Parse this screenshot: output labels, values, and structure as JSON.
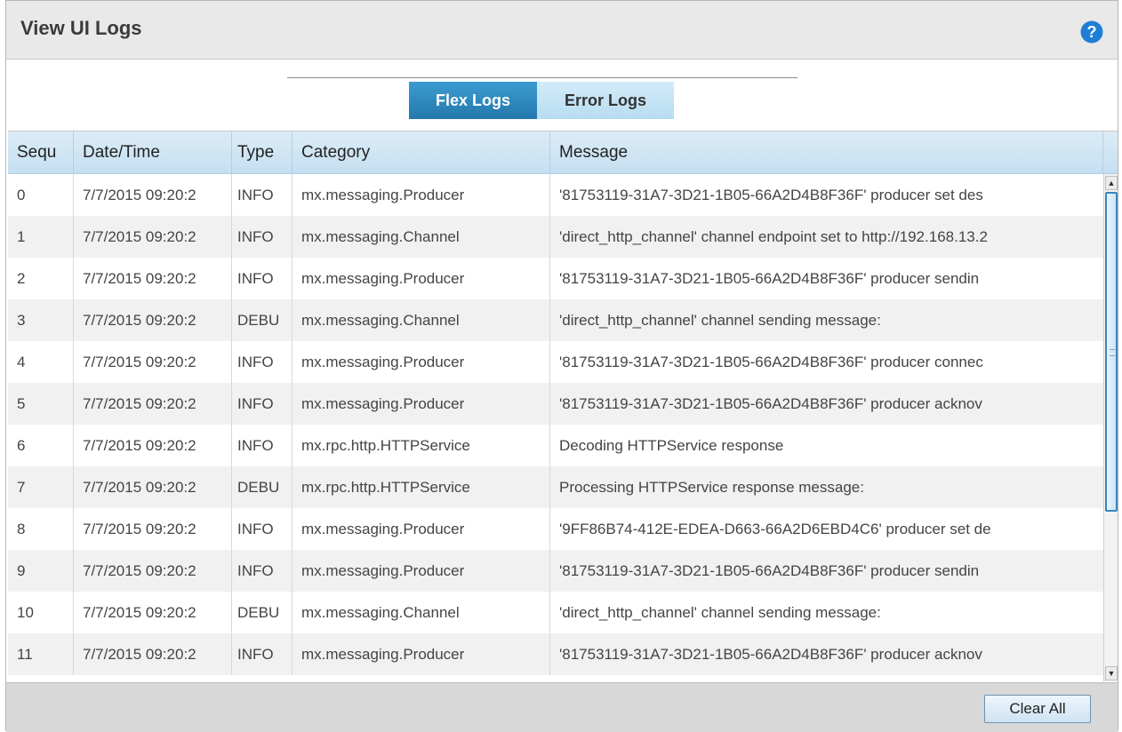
{
  "header": {
    "title": "View UI Logs"
  },
  "tabs": [
    {
      "label": "Flex Logs",
      "active": true
    },
    {
      "label": "Error Logs",
      "active": false
    }
  ],
  "table": {
    "columns": [
      "Sequ",
      "Date/Time",
      "Type",
      "Category",
      "Message"
    ],
    "rows": [
      [
        "0",
        "7/7/2015 09:20:2",
        "INFO",
        "mx.messaging.Producer",
        "'81753119-31A7-3D21-1B05-66A2D4B8F36F' producer set des"
      ],
      [
        "1",
        "7/7/2015 09:20:2",
        "INFO",
        "mx.messaging.Channel",
        "'direct_http_channel' channel endpoint set to http://192.168.13.2"
      ],
      [
        "2",
        "7/7/2015 09:20:2",
        "INFO",
        "mx.messaging.Producer",
        "'81753119-31A7-3D21-1B05-66A2D4B8F36F' producer sendin"
      ],
      [
        "3",
        "7/7/2015 09:20:2",
        "DEBU",
        "mx.messaging.Channel",
        "'direct_http_channel' channel sending message:"
      ],
      [
        "4",
        "7/7/2015 09:20:2",
        "INFO",
        "mx.messaging.Producer",
        "'81753119-31A7-3D21-1B05-66A2D4B8F36F' producer connec"
      ],
      [
        "5",
        "7/7/2015 09:20:2",
        "INFO",
        "mx.messaging.Producer",
        "'81753119-31A7-3D21-1B05-66A2D4B8F36F' producer acknov"
      ],
      [
        "6",
        "7/7/2015 09:20:2",
        "INFO",
        "mx.rpc.http.HTTPService",
        "Decoding HTTPService response"
      ],
      [
        "7",
        "7/7/2015 09:20:2",
        "DEBU",
        "mx.rpc.http.HTTPService",
        "Processing HTTPService response message:"
      ],
      [
        "8",
        "7/7/2015 09:20:2",
        "INFO",
        "mx.messaging.Producer",
        "'9FF86B74-412E-EDEA-D663-66A2D6EBD4C6' producer set de"
      ],
      [
        "9",
        "7/7/2015 09:20:2",
        "INFO",
        "mx.messaging.Producer",
        "'81753119-31A7-3D21-1B05-66A2D4B8F36F' producer sendin"
      ],
      [
        "10",
        "7/7/2015 09:20:2",
        "DEBU",
        "mx.messaging.Channel",
        "'direct_http_channel' channel sending message:"
      ],
      [
        "11",
        "7/7/2015 09:20:2",
        "INFO",
        "mx.messaging.Producer",
        "'81753119-31A7-3D21-1B05-66A2D4B8F36F' producer acknov"
      ]
    ]
  },
  "footer": {
    "clear_label": "Clear All"
  },
  "icons": {
    "help": "help-icon",
    "scroll_up": "scroll-up-icon",
    "scroll_down": "scroll-down-icon"
  },
  "colors": {
    "accent": "#2378ad",
    "tab_inactive": "#c4e2f4",
    "help_icon": "#1f7fd6"
  }
}
